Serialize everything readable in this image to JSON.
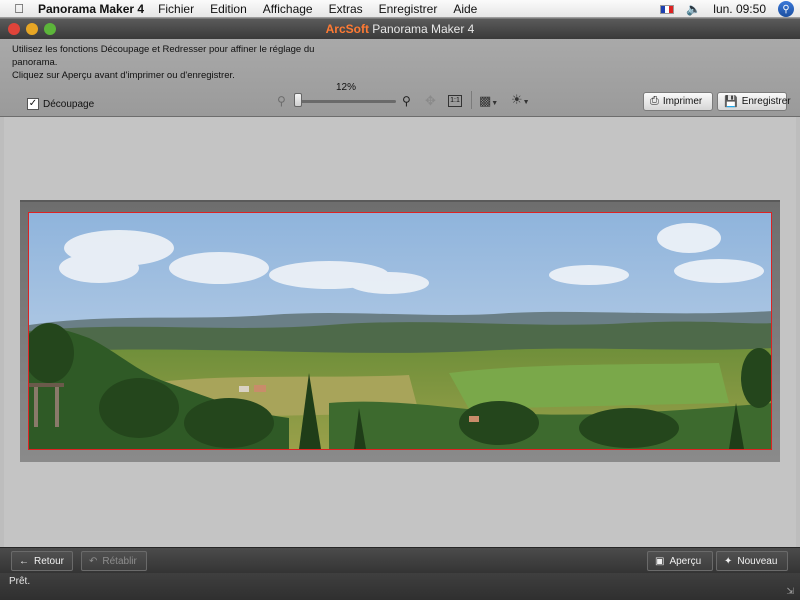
{
  "menubar": {
    "app_name": "Panorama Maker 4",
    "items": [
      "Fichier",
      "Edition",
      "Affichage",
      "Extras",
      "Enregistrer",
      "Aide"
    ],
    "clock": "lun. 09:50"
  },
  "window": {
    "title_brand": "ArcSoft",
    "title_rest": " Panorama Maker 4"
  },
  "toolbar": {
    "instruction_line1": "Utilisez les fonctions Découpage et Redresser pour affiner le réglage du panorama.",
    "instruction_line2": "Cliquez sur Aperçu avant d'imprimer ou d'enregistrer.",
    "crop_label": "Découpage",
    "crop_checked": true,
    "zoom_percent": "12%",
    "zoom_level": 0.12,
    "fit_label": "1:1",
    "print_label": "Imprimer",
    "save_label": "Enregistrer"
  },
  "bottombar": {
    "back_label": "Retour",
    "redo_label": "Rétablir",
    "preview_label": "Aperçu",
    "new_label": "Nouveau"
  },
  "status": {
    "text": "Prêt."
  },
  "icons": {
    "apple": "apple-logo-icon",
    "volume": "volume-icon",
    "spotlight": "spotlight-icon",
    "zoom_out": "zoom-out-icon",
    "zoom_in": "zoom-in-icon",
    "move": "move-icon",
    "fit": "actual-size-icon",
    "camera": "camera-icon",
    "light": "brightness-icon",
    "print": "printer-icon",
    "save": "save-disk-icon",
    "back": "arrow-left-icon",
    "redo": "redo-icon",
    "preview": "preview-icon",
    "new": "new-project-icon"
  },
  "colors": {
    "brand": "#ff7a33",
    "crop_border": "#dd2222"
  }
}
